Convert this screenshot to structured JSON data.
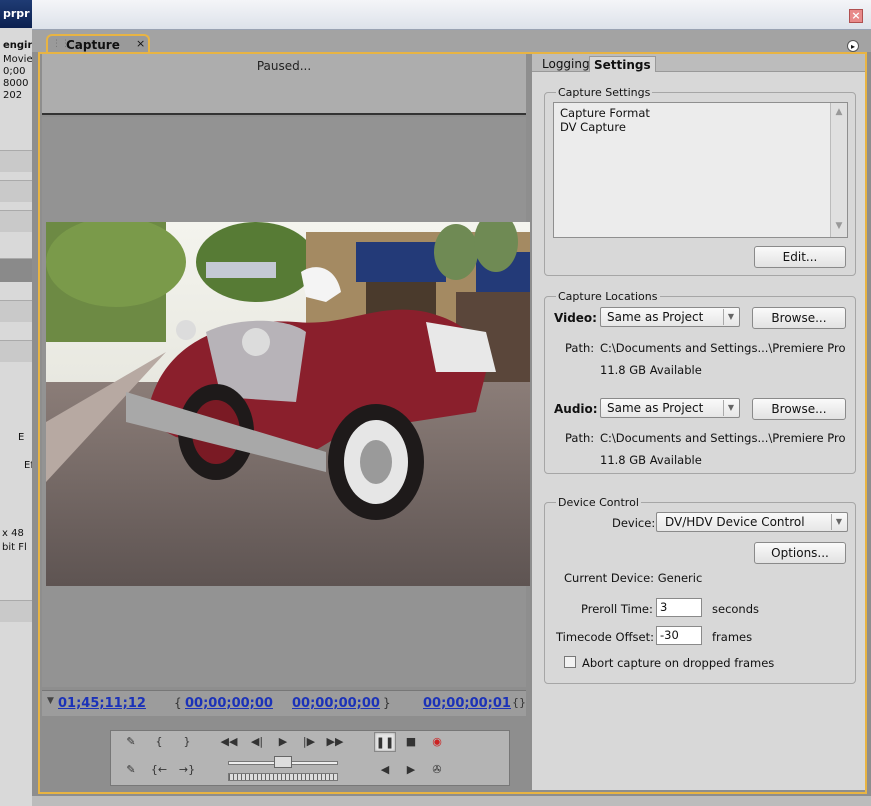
{
  "background_app": {
    "title": "prpr",
    "lines": [
      "engir",
      "Movie",
      "0;00",
      "8000",
      "202"
    ],
    "bottom_lines": [
      "x 48",
      "bit Fl"
    ],
    "side_labels": [
      "E",
      "Ef"
    ]
  },
  "window": {
    "tab_label": "Capture",
    "tab_close": "×",
    "close_button": "×"
  },
  "monitor": {
    "status": "Paused...",
    "timecode_current": "01;45;11;12",
    "in_point": "00;00;00;00",
    "out_point": "00;00;00;00",
    "duration": "00;00;00;01"
  },
  "right_tabs": [
    {
      "label": "Logging"
    },
    {
      "label": "Settings"
    }
  ],
  "capture_settings": {
    "title": "Capture Settings",
    "line1": "Capture Format",
    "line2": "DV Capture",
    "edit_button": "Edit..."
  },
  "capture_locations": {
    "title": "Capture Locations",
    "video_label": "Video:",
    "video_value": "Same as Project",
    "video_browse": "Browse...",
    "video_path_label": "Path:",
    "video_path": "C:\\Documents and Settings...\\Premiere Pro",
    "video_available": "11.8 GB Available",
    "audio_label": "Audio:",
    "audio_value": "Same as Project",
    "audio_browse": "Browse...",
    "audio_path_label": "Path:",
    "audio_path": "C:\\Documents and Settings...\\Premiere Pro",
    "audio_available": "11.8 GB Available"
  },
  "device_control": {
    "title": "Device Control",
    "device_label": "Device:",
    "device_value": "DV/HDV Device Control",
    "options_button": "Options...",
    "current_device": "Current Device: Generic",
    "preroll_label": "Preroll Time:",
    "preroll_value": "3",
    "preroll_unit": "seconds",
    "offset_label": "Timecode Offset:",
    "offset_value": "-30",
    "offset_unit": "frames",
    "abort_label": "Abort capture on dropped frames",
    "abort_checked": false
  }
}
